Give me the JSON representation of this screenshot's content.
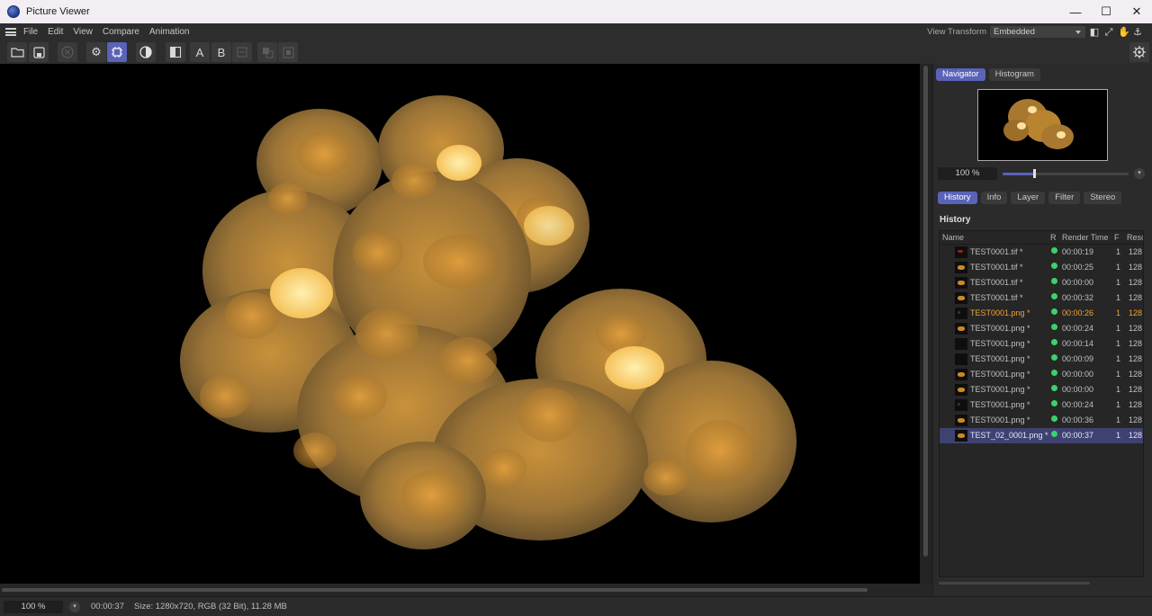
{
  "window": {
    "title": "Picture Viewer",
    "minimize": "—",
    "maximize": "☐",
    "close": "✕"
  },
  "menu": {
    "items": [
      "File",
      "Edit",
      "View",
      "Compare",
      "Animation"
    ],
    "view_transform_label": "View Transform",
    "view_transform_value": "Embedded"
  },
  "toolbar": {
    "letter_a": "A",
    "letter_b": "B"
  },
  "navigator": {
    "tabs": [
      "Navigator",
      "Histogram"
    ],
    "active_tab": "Navigator",
    "zoom_value": "100 %",
    "zoom_slider_fraction": 0.25
  },
  "history_panel": {
    "tabs": [
      "History",
      "Info",
      "Layer",
      "Filter",
      "Stereo"
    ],
    "active_tab": "History",
    "title": "History",
    "columns": [
      "Name",
      "R",
      "Render Time",
      "F",
      "Reso"
    ],
    "rows": [
      {
        "name": "TEST0001.tif *",
        "time": "00:00:19",
        "frame": "1",
        "res": "128",
        "thumb": "red",
        "state": "normal"
      },
      {
        "name": "TEST0001.tif *",
        "time": "00:00:25",
        "frame": "1",
        "res": "128",
        "thumb": "gold",
        "state": "normal"
      },
      {
        "name": "TEST0001.tif *",
        "time": "00:00:00",
        "frame": "1",
        "res": "128",
        "thumb": "gold",
        "state": "normal"
      },
      {
        "name": "TEST0001.tif *",
        "time": "00:00:32",
        "frame": "1",
        "res": "128",
        "thumb": "gold",
        "state": "normal"
      },
      {
        "name": "TEST0001.png *",
        "time": "00:00:26",
        "frame": "1",
        "res": "128",
        "thumb": "dim",
        "state": "highlight"
      },
      {
        "name": "TEST0001.png *",
        "time": "00:00:24",
        "frame": "1",
        "res": "128",
        "thumb": "gold",
        "state": "normal"
      },
      {
        "name": "TEST0001.png *",
        "time": "00:00:14",
        "frame": "1",
        "res": "128",
        "thumb": "empty",
        "state": "normal"
      },
      {
        "name": "TEST0001.png *",
        "time": "00:00:09",
        "frame": "1",
        "res": "128",
        "thumb": "empty",
        "state": "normal"
      },
      {
        "name": "TEST0001.png *",
        "time": "00:00:00",
        "frame": "1",
        "res": "128",
        "thumb": "gold",
        "state": "normal"
      },
      {
        "name": "TEST0001.png *",
        "time": "00:00:00",
        "frame": "1",
        "res": "128",
        "thumb": "gold",
        "state": "normal"
      },
      {
        "name": "TEST0001.png *",
        "time": "00:00:24",
        "frame": "1",
        "res": "128",
        "thumb": "dim",
        "state": "normal"
      },
      {
        "name": "TEST0001.png *",
        "time": "00:00:36",
        "frame": "1",
        "res": "128",
        "thumb": "gold",
        "state": "normal"
      },
      {
        "name": "TEST_02_0001.png *",
        "time": "00:00:37",
        "frame": "1",
        "res": "128",
        "thumb": "gold",
        "state": "selected"
      }
    ]
  },
  "status": {
    "zoom": "100 %",
    "render_time": "00:00:37",
    "info": "Size: 1280x720, RGB (32 Bit), 11.28 MB"
  },
  "colors": {
    "accent": "#5a63b8",
    "highlight_text": "#f0a43a",
    "status_dot": "#3bd16b",
    "render_gold": "#e8a43a"
  }
}
